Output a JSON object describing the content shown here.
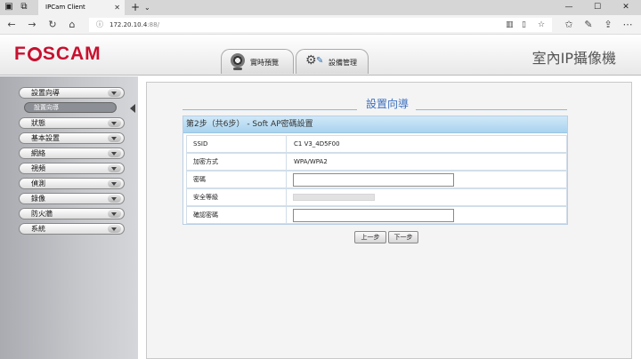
{
  "browser": {
    "tab_title": "IPCam Client",
    "tab_close": "✕",
    "new_tab": "+",
    "tab_dropdown": "⌄",
    "url_host": "172.20.10.4",
    "url_rest": ":88/",
    "window_controls": [
      "—",
      "☐",
      "✕"
    ]
  },
  "header": {
    "logo_left": "F",
    "logo_right": "SCAM",
    "tabs": [
      {
        "label": "實時預覽"
      },
      {
        "label": "設備管理"
      }
    ],
    "product_title": "室內IP攝像機"
  },
  "sidebar": {
    "items": [
      {
        "label": "設置向導"
      },
      {
        "label": "狀態"
      },
      {
        "label": "基本設置"
      },
      {
        "label": "網絡"
      },
      {
        "label": "視頻"
      },
      {
        "label": "偵測"
      },
      {
        "label": "錄像"
      },
      {
        "label": "防火牆"
      },
      {
        "label": "系統"
      }
    ],
    "submenu": {
      "label": "設置向導"
    }
  },
  "content": {
    "title": "設置向導",
    "step_header": "第2步（共6步） - Soft AP密碼設置",
    "rows": [
      {
        "label": "SSID",
        "value": "C1 V3_4D5F00"
      },
      {
        "label": "加密方式",
        "value": "WPA/WPA2"
      },
      {
        "label": "密碼",
        "value": ""
      },
      {
        "label": "安全等級",
        "value": ""
      },
      {
        "label": "確認密碼",
        "value": ""
      }
    ],
    "password_strength": 0,
    "prev_button": "上一步",
    "next_button": "下一步"
  },
  "colors": {
    "brand": "#c8102e",
    "accent": "#3b6fc0",
    "step_header_bg": "#a9d3ef"
  }
}
